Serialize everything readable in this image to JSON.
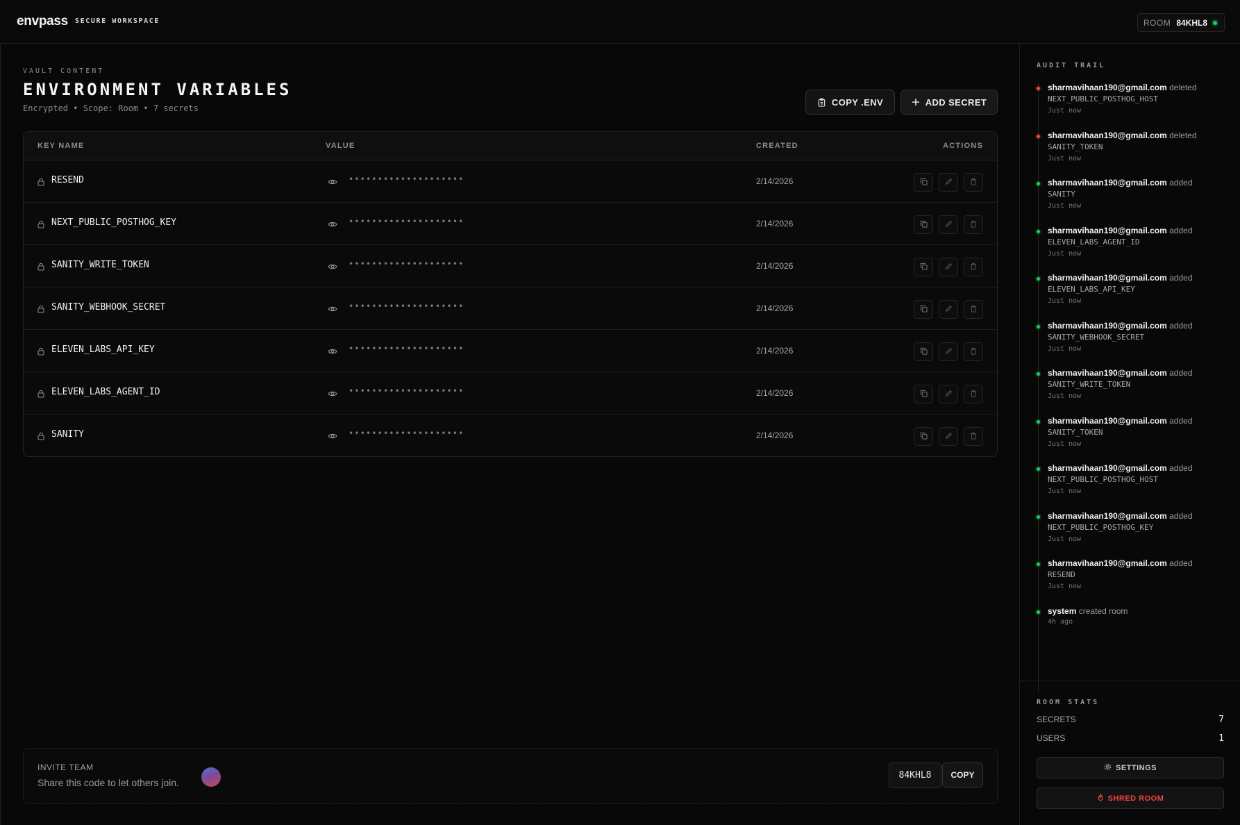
{
  "header": {
    "brand": "envpass",
    "tag": "SECURE WORKSPACE",
    "room_label": "ROOM",
    "room_code": "84KHL8",
    "status_color": "#22c55e"
  },
  "main": {
    "eyebrow": "VAULT CONTENT",
    "title": "ENVIRONMENT VARIABLES",
    "subtitle": "Encrypted • Scope: Room • 7 secrets",
    "copy_env_label": "COPY .ENV",
    "add_secret_label": "ADD SECRET"
  },
  "table": {
    "columns": [
      "KEY NAME",
      "VALUE",
      "CREATED",
      "ACTIONS"
    ],
    "rows": [
      {
        "key": "RESEND",
        "value": "••••••••••••••••••••",
        "created": "2/14/2026"
      },
      {
        "key": "NEXT_PUBLIC_POSTHOG_KEY",
        "value": "••••••••••••••••••••",
        "created": "2/14/2026"
      },
      {
        "key": "SANITY_WRITE_TOKEN",
        "value": "••••••••••••••••••••",
        "created": "2/14/2026"
      },
      {
        "key": "SANITY_WEBHOOK_SECRET",
        "value": "••••••••••••••••••••",
        "created": "2/14/2026"
      },
      {
        "key": "ELEVEN_LABS_API_KEY",
        "value": "••••••••••••••••••••",
        "created": "2/14/2026"
      },
      {
        "key": "ELEVEN_LABS_AGENT_ID",
        "value": "••••••••••••••••••••",
        "created": "2/14/2026"
      },
      {
        "key": "SANITY",
        "value": "••••••••••••••••••••",
        "created": "2/14/2026"
      }
    ]
  },
  "invite": {
    "title": "INVITE TEAM",
    "description": "Share this code to let others join.",
    "code": "84KHL8",
    "copy_label": "COPY"
  },
  "audit": {
    "title": "AUDIT TRAIL",
    "items": [
      {
        "user": "sharmavihaan190@gmail.com",
        "action": "deleted",
        "key": "NEXT_PUBLIC_POSTHOG_HOST",
        "time": "Just now",
        "status": "red"
      },
      {
        "user": "sharmavihaan190@gmail.com",
        "action": "deleted",
        "key": "SANITY_TOKEN",
        "time": "Just now",
        "status": "red"
      },
      {
        "user": "sharmavihaan190@gmail.com",
        "action": "added",
        "key": "SANITY",
        "time": "Just now",
        "status": "green"
      },
      {
        "user": "sharmavihaan190@gmail.com",
        "action": "added",
        "key": "ELEVEN_LABS_AGENT_ID",
        "time": "Just now",
        "status": "green"
      },
      {
        "user": "sharmavihaan190@gmail.com",
        "action": "added",
        "key": "ELEVEN_LABS_API_KEY",
        "time": "Just now",
        "status": "green"
      },
      {
        "user": "sharmavihaan190@gmail.com",
        "action": "added",
        "key": "SANITY_WEBHOOK_SECRET",
        "time": "Just now",
        "status": "green"
      },
      {
        "user": "sharmavihaan190@gmail.com",
        "action": "added",
        "key": "SANITY_WRITE_TOKEN",
        "time": "Just now",
        "status": "green"
      },
      {
        "user": "sharmavihaan190@gmail.com",
        "action": "added",
        "key": "SANITY_TOKEN",
        "time": "Just now",
        "status": "green"
      },
      {
        "user": "sharmavihaan190@gmail.com",
        "action": "added",
        "key": "NEXT_PUBLIC_POSTHOG_HOST",
        "time": "Just now",
        "status": "green"
      },
      {
        "user": "sharmavihaan190@gmail.com",
        "action": "added",
        "key": "NEXT_PUBLIC_POSTHOG_KEY",
        "time": "Just now",
        "status": "green"
      },
      {
        "user": "sharmavihaan190@gmail.com",
        "action": "added",
        "key": "RESEND",
        "time": "Just now",
        "status": "green"
      },
      {
        "user": "system",
        "action": "created room",
        "key": "",
        "time": "4h ago",
        "status": "green"
      }
    ]
  },
  "stats": {
    "title": "ROOM STATS",
    "secrets_label": "SECRETS",
    "secrets_value": "7",
    "users_label": "USERS",
    "users_value": "1",
    "settings_label": "SETTINGS",
    "shred_label": "SHRED ROOM",
    "danger_color": "#ef4444"
  }
}
